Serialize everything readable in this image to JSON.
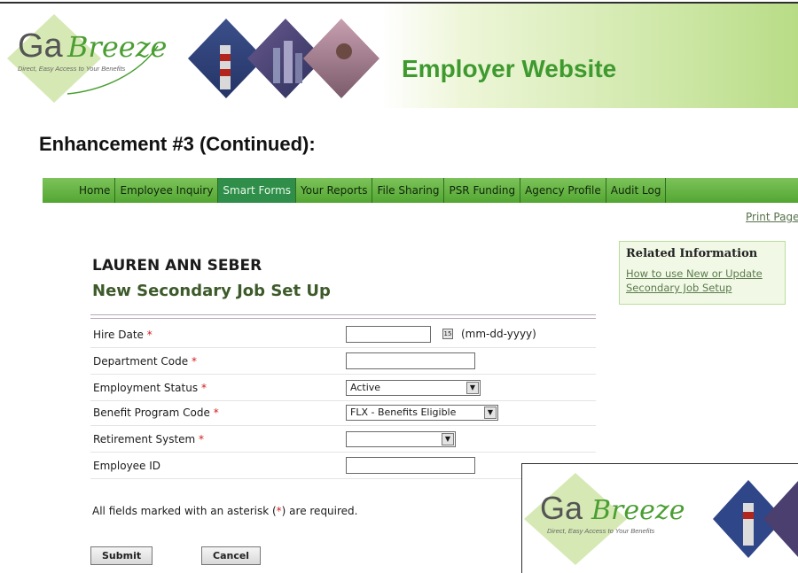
{
  "header": {
    "logo_text_ga": "Ga",
    "logo_text_breeze": "Breeze",
    "logo_tagline": "Direct, Easy Access to Your Benefits",
    "site_title": "Employer Website",
    "brand_green": "#3e9a2e",
    "logo_diamond_color": "#d6e9b4"
  },
  "page_heading": "Enhancement #3 (Continued):",
  "nav": {
    "items": [
      {
        "label": "Home"
      },
      {
        "label": "Employee Inquiry"
      },
      {
        "label": "Smart Forms",
        "active": true
      },
      {
        "label": "Your Reports"
      },
      {
        "label": "File Sharing"
      },
      {
        "label": "PSR Funding"
      },
      {
        "label": "Agency Profile"
      },
      {
        "label": "Audit Log"
      }
    ]
  },
  "print_link": "Print Page",
  "person_name": "LAUREN ANN SEBER",
  "form": {
    "title": "New Secondary Job Set Up",
    "fields": {
      "hire_date": {
        "label": "Hire Date",
        "value": "",
        "hint": "(mm-dd-yyyy)",
        "required": true
      },
      "department_code": {
        "label": "Department Code",
        "value": "",
        "required": true
      },
      "employment_status": {
        "label": "Employment Status",
        "value": "Active",
        "required": true
      },
      "benefit_program_code": {
        "label": "Benefit Program Code",
        "value": "FLX - Benefits Eligible",
        "required": true
      },
      "retirement_system": {
        "label": "Retirement System",
        "value": "",
        "required": true
      },
      "employee_id": {
        "label": "Employee ID",
        "value": "",
        "required": false
      }
    },
    "required_asterisk": "*",
    "required_note_prefix": "All fields marked with an asterisk (",
    "required_note_suffix": ") are required.",
    "submit_label": "Submit",
    "cancel_label": "Cancel"
  },
  "related": {
    "title": "Related Information",
    "link_line1": "How to use New or Update",
    "link_line2": "Secondary Job Setup"
  },
  "inset": {
    "logo_text_ga": "Ga",
    "logo_text_breeze": "Breeze",
    "logo_tagline": "Direct, Easy Access to Your Benefits"
  }
}
